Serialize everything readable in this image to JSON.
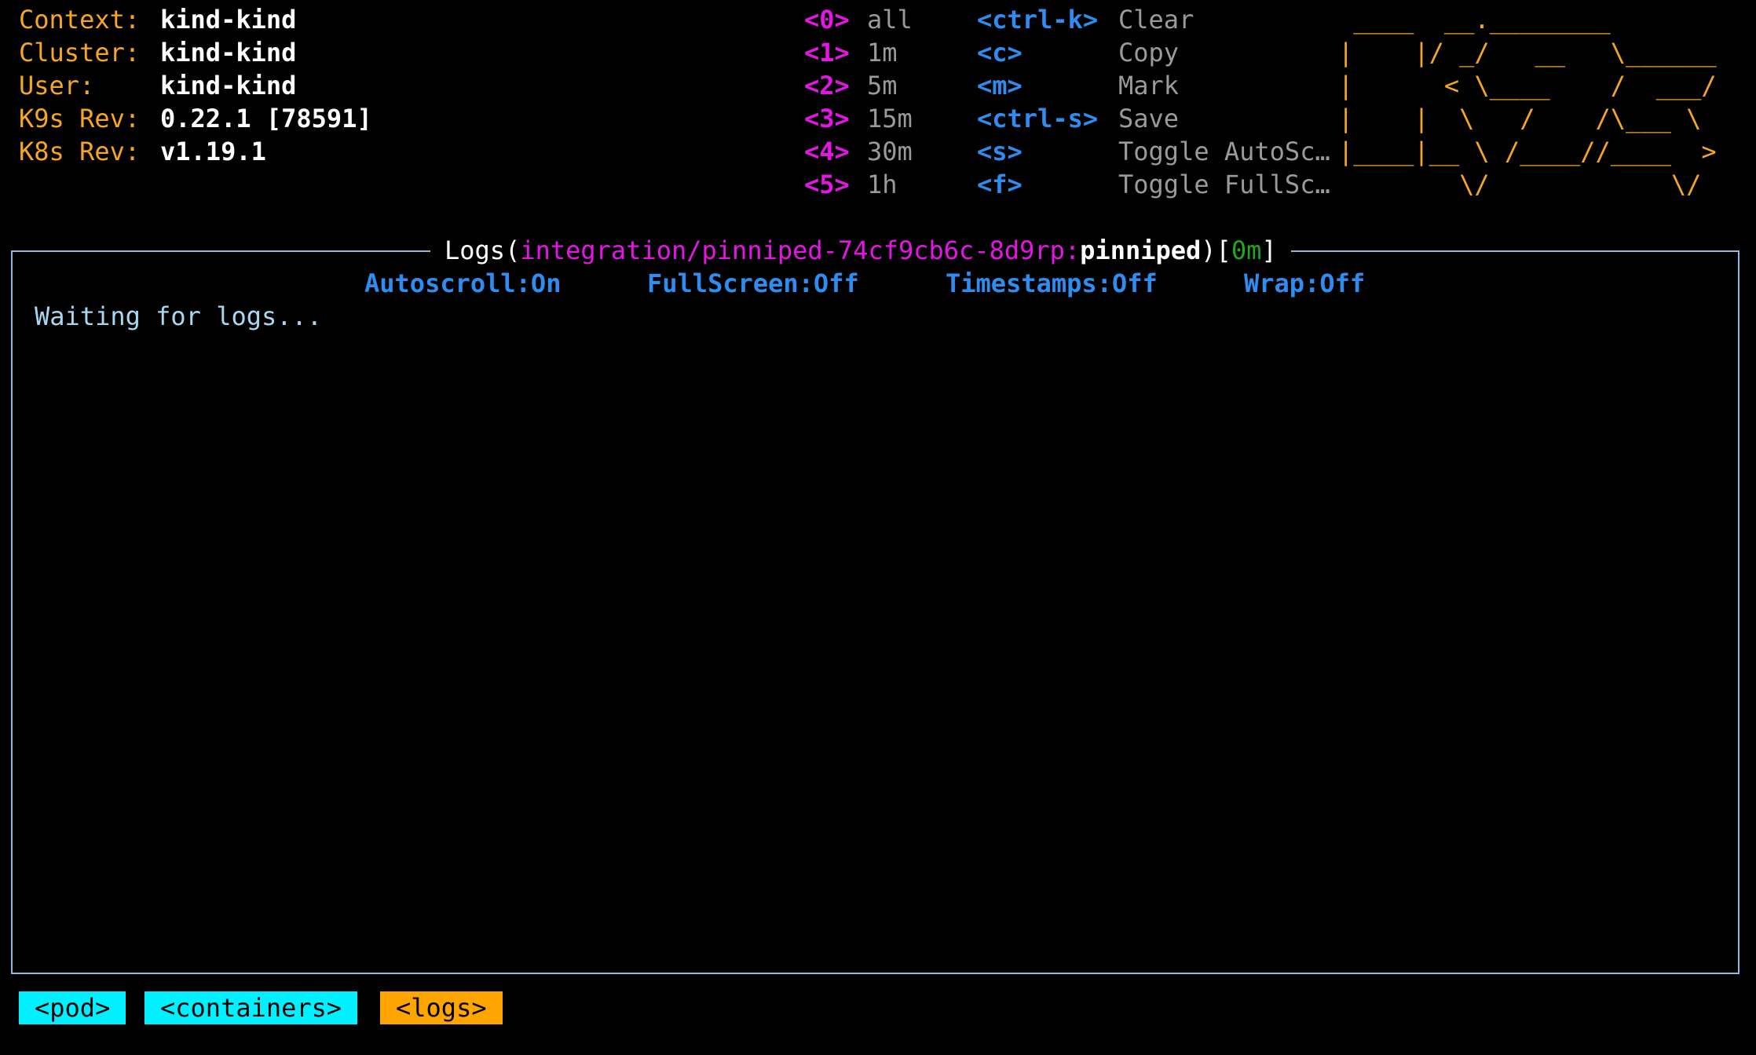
{
  "cluster_info": [
    {
      "label": "Context:",
      "value": "kind-kind"
    },
    {
      "label": "Cluster:",
      "value": "kind-kind"
    },
    {
      "label": "User:",
      "value": "kind-kind"
    },
    {
      "label": "K9s Rev:",
      "value": "0.22.1 [78591]"
    },
    {
      "label": "K8s Rev:",
      "value": "v1.19.1"
    }
  ],
  "time_hotkeys": [
    {
      "key": "<0>",
      "desc": "all"
    },
    {
      "key": "<1>",
      "desc": "1m"
    },
    {
      "key": "<2>",
      "desc": "5m"
    },
    {
      "key": "<3>",
      "desc": "15m"
    },
    {
      "key": "<4>",
      "desc": "30m"
    },
    {
      "key": "<5>",
      "desc": "1h"
    }
  ],
  "action_hotkeys": [
    {
      "key": "<ctrl-k>",
      "desc": "Clear"
    },
    {
      "key": "<c>",
      "desc": "Copy"
    },
    {
      "key": "<m>",
      "desc": "Mark"
    },
    {
      "key": "<ctrl-s>",
      "desc": "Save"
    },
    {
      "key": "<s>",
      "desc": "Toggle AutoSc…"
    },
    {
      "key": "<f>",
      "desc": "Toggle FullSc…"
    }
  ],
  "logo_lines": [
    " ____  __.________       ",
    "|    |/ _/   __   \\______",
    "|      < \\____    /  ___/",
    "|    |  \\   /    /\\___ \\ ",
    "|____|__ \\ /____//____  >",
    "        \\/            \\/ "
  ],
  "log_view": {
    "title_prefix": "Logs(",
    "pod_path": "integration/pinniped-74cf9cb6c-8d9rp:",
    "container": "pinniped",
    "title_close": ")[",
    "since": "0m",
    "title_end": "]",
    "status": {
      "autoscroll": "Autoscroll:On",
      "fullscreen": "FullScreen:Off",
      "timestamps": "Timestamps:Off",
      "wrap": "Wrap:Off"
    },
    "message": "Waiting for logs..."
  },
  "breadcrumbs": [
    "<pod>",
    "<containers>",
    "<logs>"
  ],
  "colors": {
    "background": "#000000",
    "label": "#f5a623",
    "hotkey_magenta": "#e516e5",
    "hotkey_blue": "#2f8cf0",
    "border": "#8fb8e6",
    "crumb_inactive": "#00f0ff",
    "crumb_active": "#ffa500"
  }
}
